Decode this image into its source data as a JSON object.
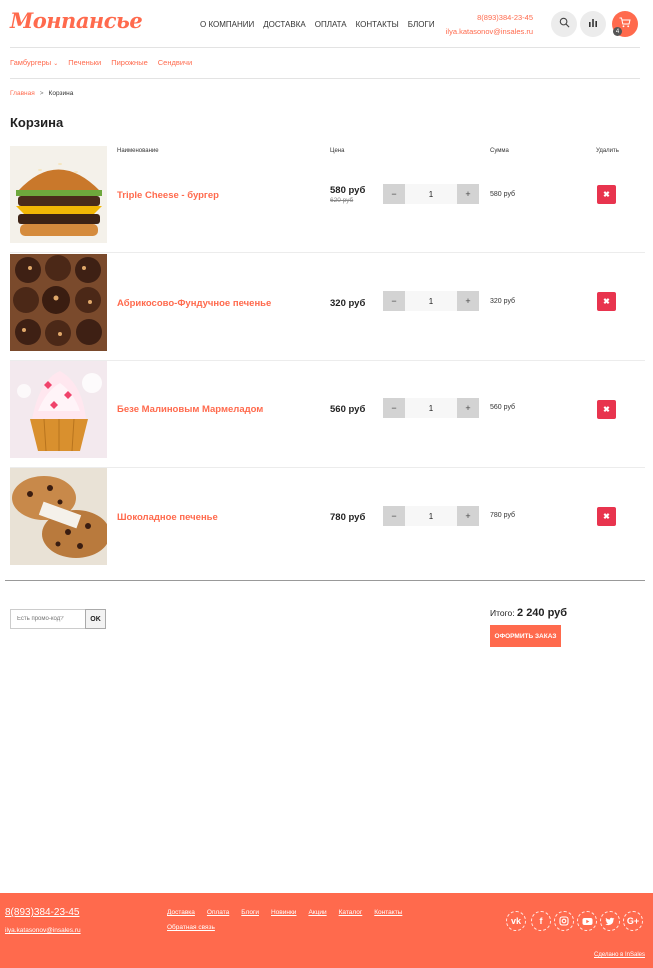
{
  "header": {
    "logo": "Монпансье",
    "nav": [
      "О КОМПАНИИ",
      "ДОСТАВКА",
      "ОПЛАТА",
      "КОНТАКТЫ",
      "БЛОГИ"
    ],
    "phone": "8(893)384-23-45",
    "email": "ilya.katasonov@insales.ru",
    "cart_count": "4",
    "icons": [
      "search-icon",
      "stats-icon",
      "cart-icon"
    ]
  },
  "categories": [
    "Гамбургеры",
    "Печеньки",
    "Пирожные",
    "Сендвичи"
  ],
  "breadcrumb": {
    "home": "Главная",
    "separator": ">",
    "current": "Корзина"
  },
  "page_title": "Корзина",
  "columns": {
    "name": "Наименование",
    "price": "Цена",
    "sum": "Сумма",
    "delete": "Удалить"
  },
  "items": [
    {
      "name": "Triple Cheese - бургер",
      "price": "580 руб",
      "old_price": "620 руб",
      "qty": "1",
      "sum": "580 руб",
      "minus": "−",
      "plus": "+",
      "delete_icon": "✖"
    },
    {
      "name": "Абрикосово-Фундучное печенье",
      "price": "320 руб",
      "qty": "1",
      "sum": "320 руб",
      "minus": "−",
      "plus": "+",
      "delete_icon": "✖"
    },
    {
      "name": "Безе Малиновым Мармеладом",
      "price": "560 руб",
      "qty": "1",
      "sum": "560 руб",
      "minus": "−",
      "plus": "+",
      "delete_icon": "✖"
    },
    {
      "name": "Шоколадное печенье",
      "price": "780 руб",
      "qty": "1",
      "sum": "780 руб",
      "minus": "−",
      "plus": "+",
      "delete_icon": "✖"
    }
  ],
  "promo": {
    "placeholder": "Есть промо-код?",
    "ok": "OK"
  },
  "total": {
    "label": "Итого:",
    "value": "2 240 руб"
  },
  "checkout_label": "ОФОРМИТЬ ЗАКАЗ",
  "footer": {
    "phone": "8(893)384-23-45",
    "email": "ilya.katasonov@insales.ru",
    "links": [
      "Доставка",
      "Оплата",
      "Блоги",
      "Новинки",
      "Акции",
      "Каталог",
      "Контакты",
      "Обратная связь"
    ],
    "social": [
      "vk-icon",
      "facebook-icon",
      "instagram-icon",
      "youtube-icon",
      "twitter-icon",
      "google-plus-icon"
    ],
    "made_by": "Сделано в InSales"
  },
  "colors": {
    "accent": "#ff6a4d",
    "delete": "#e8344e"
  }
}
